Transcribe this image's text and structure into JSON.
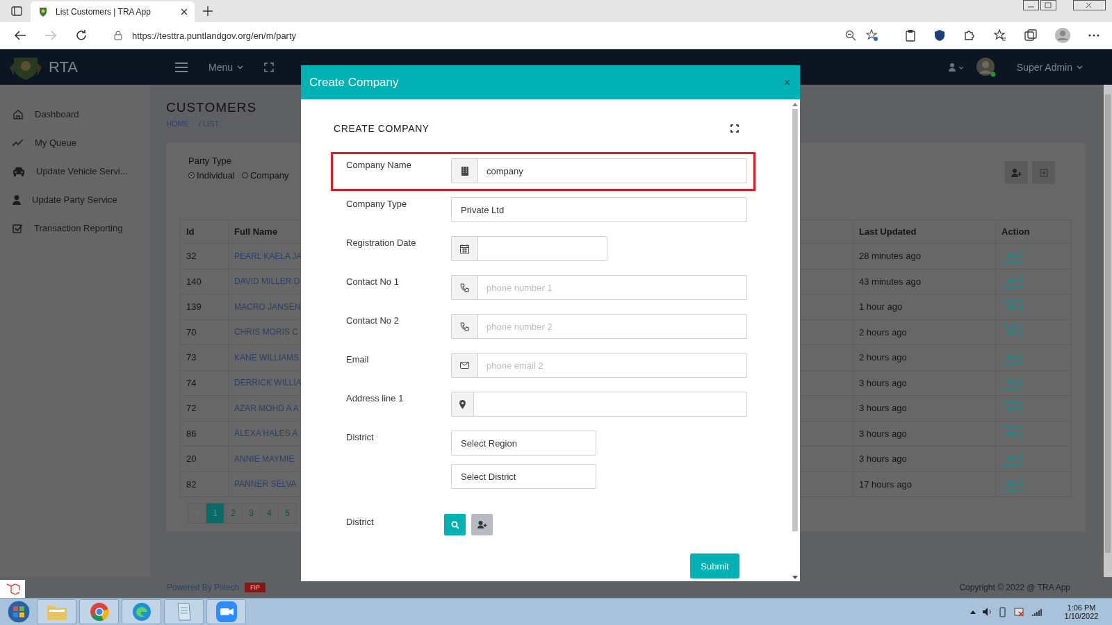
{
  "browser": {
    "tab": {
      "title": "List Customers | TRA App",
      "selected": true
    },
    "url": "https://testtra.puntlandgov.org/en/m/party"
  },
  "header": {
    "brand": "RTA",
    "menu": "Menu",
    "user": "Super Admin"
  },
  "sidebar": {
    "items": [
      {
        "label": "Dashboard",
        "kind": "home"
      },
      {
        "label": "My Queue",
        "kind": "trend"
      },
      {
        "label": "Update Vehicle Servi...",
        "kind": "car"
      },
      {
        "label": "Update Party Service",
        "kind": "user"
      },
      {
        "label": "Transaction Reporting",
        "kind": "check"
      }
    ]
  },
  "page": {
    "title": "CUSTOMERS",
    "breadcrumb": [
      "HOME",
      "/ LIST"
    ]
  },
  "filter": {
    "label": "Party Type",
    "options": [
      {
        "label": "Individual",
        "selected": true
      },
      {
        "label": "Company",
        "selected": false
      }
    ]
  },
  "table": {
    "columns": [
      "Id",
      "Full Name",
      "Last Updated",
      "Action"
    ],
    "rows": [
      {
        "id": "32",
        "name": "PEARL KAELA JA",
        "updated": "28 minutes ago"
      },
      {
        "id": "140",
        "name": "DAVID MILLER D",
        "updated": "43 minutes ago"
      },
      {
        "id": "139",
        "name": "MACRO JANSEN",
        "updated": "1 hour ago"
      },
      {
        "id": "70",
        "name": "CHRIS MORIS C",
        "updated": "2 hours ago"
      },
      {
        "id": "73",
        "name": "KANE WILLIAMS",
        "updated": "2 hours ago"
      },
      {
        "id": "74",
        "name": "DERRICK WILLIA",
        "updated": "3 hours ago"
      },
      {
        "id": "72",
        "name": "AZAR MOHD A A",
        "updated": "3 hours ago"
      },
      {
        "id": "86",
        "name": "ALEXA HALES A",
        "updated": "3 hours ago"
      },
      {
        "id": "20",
        "name": "ANNIE MAYMIE",
        "updated": "3 hours ago"
      },
      {
        "id": "82",
        "name": "PANNER SELVA",
        "updated": "17 hours ago"
      }
    ]
  },
  "pagination": {
    "pages": [
      {
        "label": "1",
        "selected": true
      },
      {
        "label": "2",
        "selected": false
      },
      {
        "label": "3",
        "selected": false
      },
      {
        "label": "4",
        "selected": false
      },
      {
        "label": "5",
        "selected": false
      }
    ]
  },
  "footer": {
    "powered": "Powered By Piitech",
    "badge": "FIP",
    "copyright": "Copyright © 2022 @ TRA App"
  },
  "modal": {
    "title": "Create Company",
    "close": "×",
    "heading": "CREATE COMPANY",
    "fields": [
      {
        "label": "Company Name",
        "kind": "building",
        "value": "company",
        "highlighted": true
      },
      {
        "label": "Company Type",
        "kind": "plain",
        "value": "Private Ltd",
        "highlighted": false
      },
      {
        "label": "Registration Date",
        "kind": "date",
        "highlighted": false
      },
      {
        "label": "Contact No 1",
        "kind": "phone",
        "placeholder": "phone number 1",
        "highlighted": false
      },
      {
        "label": "Contact No 2",
        "kind": "phone",
        "placeholder": "phone number 2",
        "highlighted": false
      },
      {
        "label": "Email",
        "kind": "email",
        "placeholder": "phone email 2",
        "highlighted": false
      },
      {
        "label": "Address line 1",
        "kind": "address",
        "highlighted": false
      },
      {
        "label": "District",
        "kind": "selects",
        "values": [
          "Select Region",
          "Select District"
        ],
        "highlighted": false
      },
      {
        "label": "District",
        "kind": "actions",
        "highlighted": false
      }
    ],
    "submit": "Submit"
  },
  "taskbar": {
    "time": "1:06 PM",
    "date": "1/10/2022"
  }
}
